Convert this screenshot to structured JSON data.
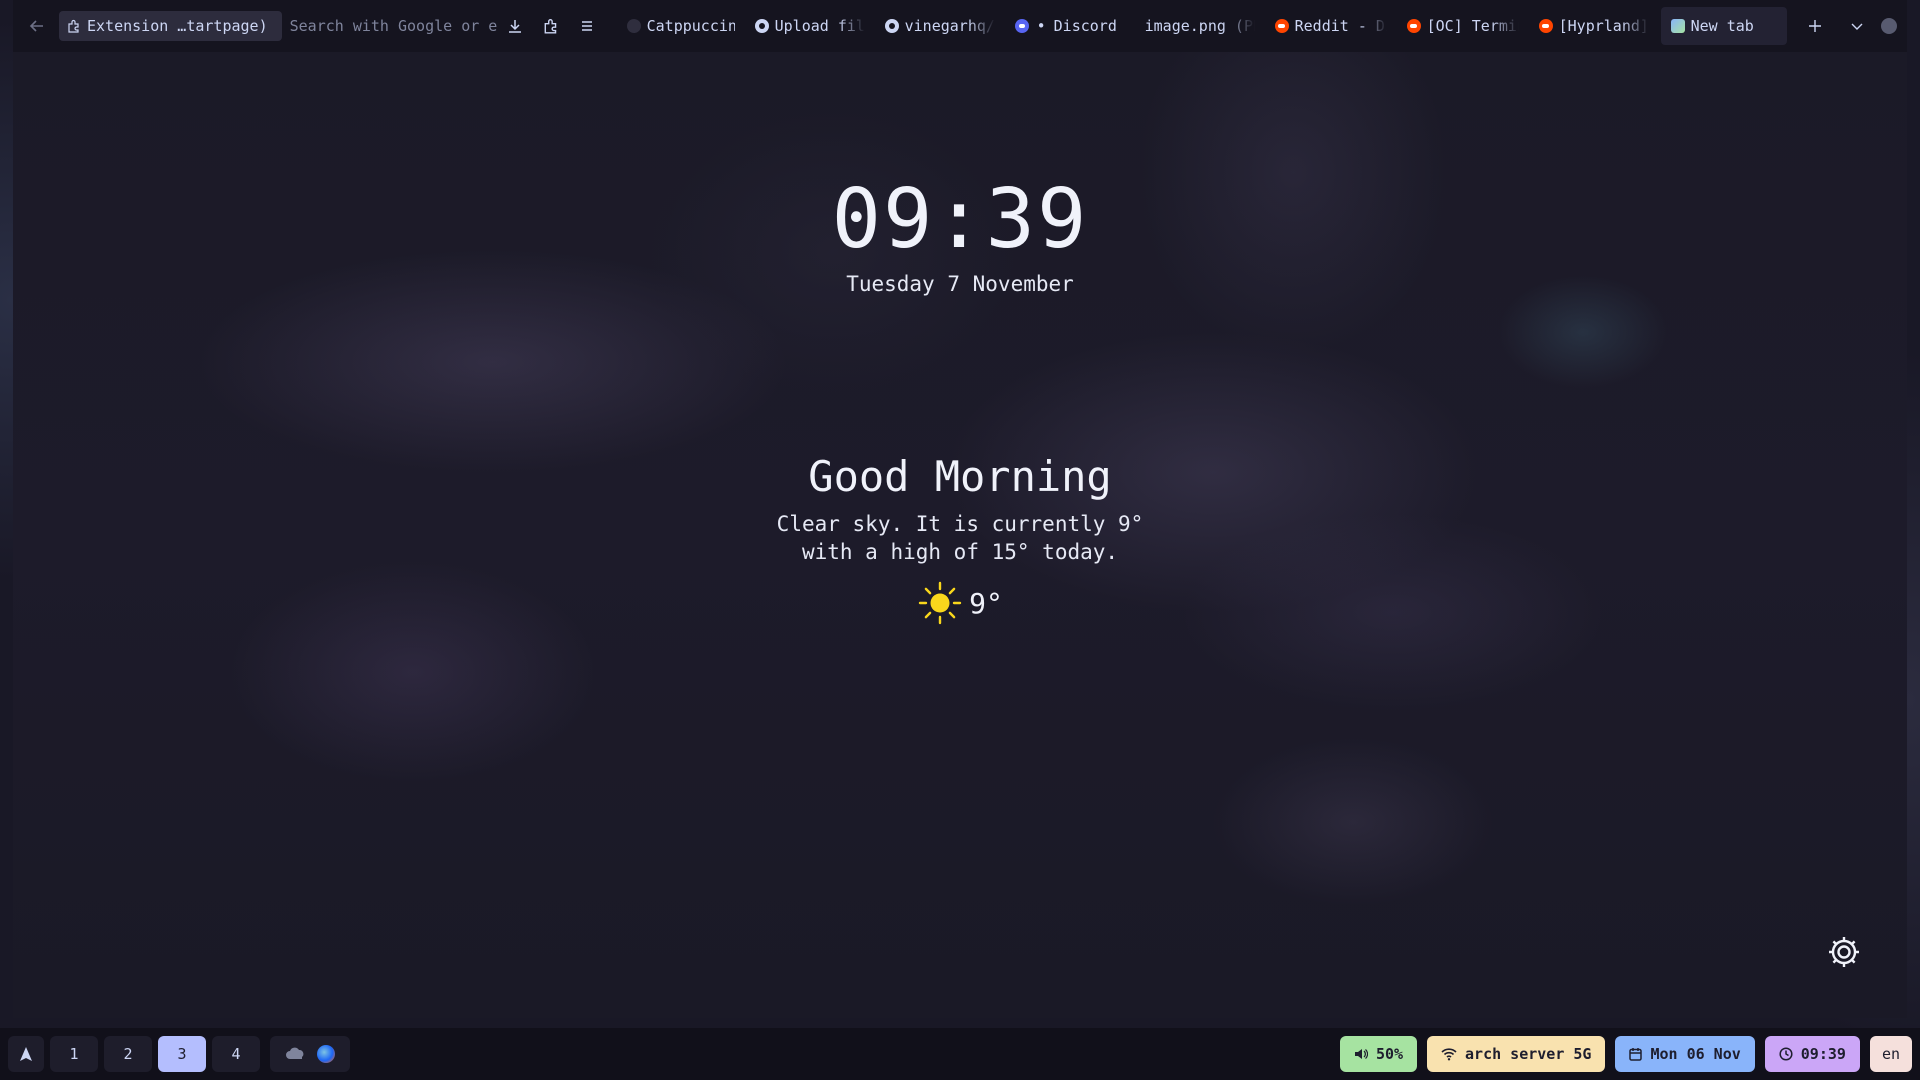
{
  "browser": {
    "url_pill": "Extension …tartpage)",
    "search_placeholder": "Search with Google or enter address",
    "tabs": [
      {
        "label": "Catppuccin",
        "icon": "catppuccin-icon"
      },
      {
        "label": "Upload files",
        "icon": "github-icon"
      },
      {
        "label": "vinegarhq/",
        "icon": "github-icon"
      },
      {
        "label": "Discord",
        "icon": "discord-icon"
      },
      {
        "label": "image.png (PNG Image)",
        "icon": "image-icon"
      },
      {
        "label": "Reddit - Dive into anything",
        "icon": "reddit-icon"
      },
      {
        "label": "[OC] Terminal",
        "icon": "reddit-icon"
      },
      {
        "label": "[Hyprland]",
        "icon": "reddit-icon"
      },
      {
        "label": "New tab",
        "icon": "new-tab-icon"
      }
    ],
    "discord_dot": "•"
  },
  "startpage": {
    "time": "09:39",
    "date": "Tuesday 7 November",
    "greeting": "Good Morning",
    "weather_line1": "Clear sky. It is currently 9°",
    "weather_line2": "with a high of 15° today.",
    "current_temp": "9°",
    "weather_icon": "sun-icon"
  },
  "taskbar": {
    "workspaces": [
      "1",
      "2",
      "3",
      "4"
    ],
    "active_workspace": "3",
    "volume": "50%",
    "network": "arch server 5G",
    "calendar": "Mon 06 Nov",
    "clock": "09:39",
    "language": "en"
  },
  "colors": {
    "accent_workspace": "#b4befe",
    "volume": "#a6e3a1",
    "network": "#f9e2af",
    "calendar": "#89b4fa",
    "clock": "#cba6f7",
    "language": "#f5e0dc"
  }
}
